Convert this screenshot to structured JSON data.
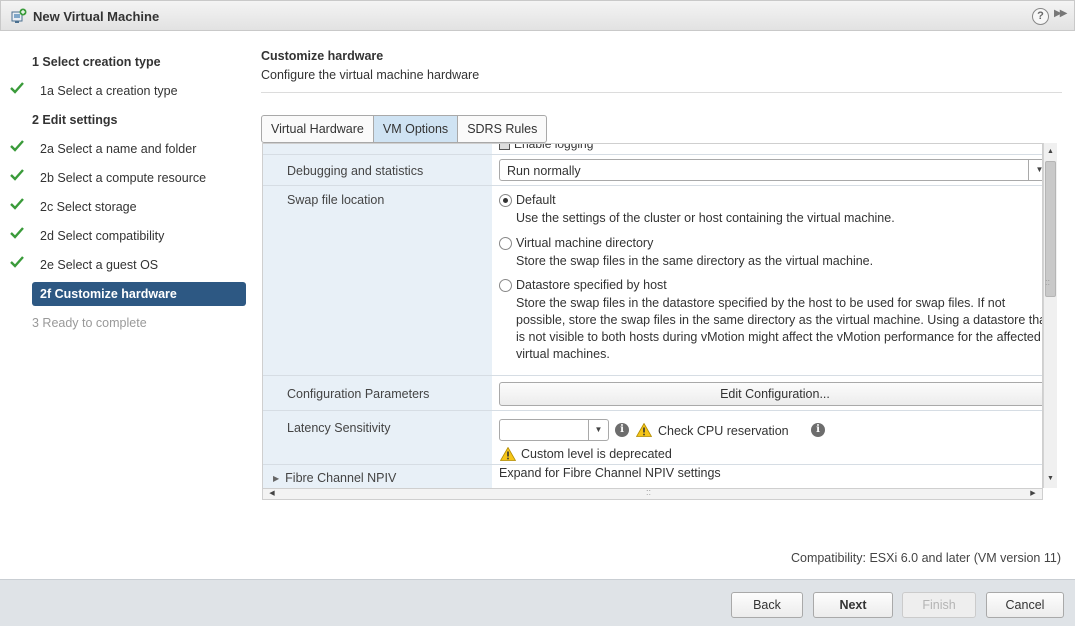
{
  "window": {
    "title": "New Virtual Machine",
    "icons": {
      "app": "new-vm-icon",
      "help": "help-icon",
      "expand": "double-chevron-right-icon"
    },
    "help_glyph": "?"
  },
  "wizard": {
    "steps": [
      {
        "label": "1  Select creation type",
        "state": "header"
      },
      {
        "label": "1a  Select a creation type",
        "state": "done"
      },
      {
        "label": "2  Edit settings",
        "state": "header"
      },
      {
        "label": "2a  Select a name and folder",
        "state": "done"
      },
      {
        "label": "2b  Select a compute resource",
        "state": "done"
      },
      {
        "label": "2c  Select storage",
        "state": "done"
      },
      {
        "label": "2d  Select compatibility",
        "state": "done"
      },
      {
        "label": "2e  Select a guest OS",
        "state": "done"
      },
      {
        "label": "2f  Customize hardware",
        "state": "active"
      },
      {
        "label": "3  Ready to complete",
        "state": "disabled"
      }
    ],
    "check_color": "#3a9b3a",
    "active_color": "#2d5883"
  },
  "main": {
    "title": "Customize hardware",
    "subtitle": "Configure the virtual machine hardware",
    "tabs": [
      {
        "label": "Virtual Hardware",
        "active": false
      },
      {
        "label": "VM Options",
        "active": true
      },
      {
        "label": "SDRS Rules",
        "active": false
      }
    ]
  },
  "settings": {
    "clipped_checkbox_label": "Enable logging",
    "debugging": {
      "label": "Debugging and statistics",
      "value": "Run normally"
    },
    "swap": {
      "label": "Swap file location",
      "options": [
        {
          "title": "Default",
          "desc": "Use the settings of the cluster or host containing the virtual machine.",
          "checked": true
        },
        {
          "title": "Virtual machine directory",
          "desc": "Store the swap files in the same directory as the virtual machine.",
          "checked": false
        },
        {
          "title": "Datastore specified by host",
          "desc": "Store the swap files in the datastore specified by the host to be used for swap files. If not possible, store the swap files in the same directory as the virtual machine. Using a datastore that is not visible to both hosts during vMotion might affect the vMotion performance for the affected virtual machines.",
          "checked": false
        }
      ]
    },
    "config_params": {
      "label": "Configuration Parameters",
      "button": "Edit Configuration..."
    },
    "latency": {
      "label": "Latency Sensitivity",
      "select_value": "",
      "cpu_reservation": "Check CPU reservation",
      "deprecated_note": "Custom level is deprecated"
    },
    "npiv": {
      "label": "Fibre Channel NPIV",
      "value": "Expand for Fibre Channel NPIV settings"
    }
  },
  "compatibility": "Compatibility: ESXi 6.0 and later (VM version 11)",
  "footer": {
    "back": "Back",
    "next": "Next",
    "finish": "Finish",
    "cancel": "Cancel"
  }
}
